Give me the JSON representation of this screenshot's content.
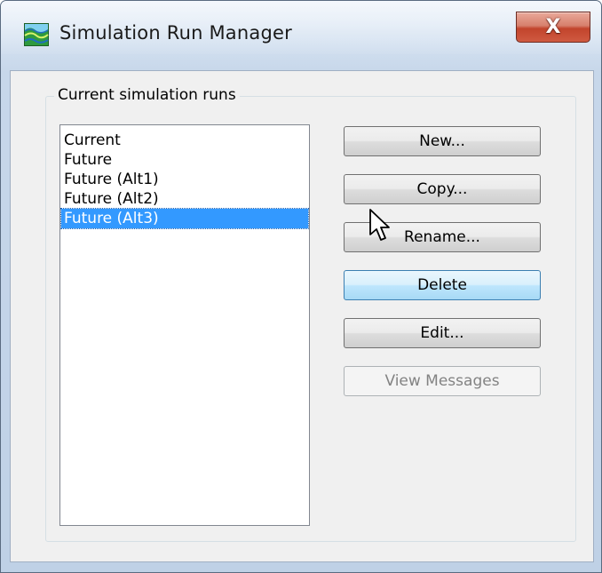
{
  "window": {
    "title": "Simulation Run Manager",
    "close_glyph": "X",
    "app_icon": "simulation-app-icon"
  },
  "group": {
    "title": "Current simulation runs"
  },
  "runs": {
    "items": [
      {
        "label": "Current",
        "selected": false
      },
      {
        "label": "Future",
        "selected": false
      },
      {
        "label": "Future (Alt1)",
        "selected": false
      },
      {
        "label": "Future (Alt2)",
        "selected": false
      },
      {
        "label": "Future (Alt3)",
        "selected": true
      }
    ]
  },
  "buttons": {
    "new_label": "New...",
    "copy_label": "Copy...",
    "rename_label": "Rename...",
    "delete_label": "Delete",
    "edit_label": "Edit...",
    "view_messages_label": "View Messages"
  },
  "colors": {
    "selection": "#3399ff",
    "close_button": "#c2442c",
    "hover_button": "#bee6fd"
  },
  "cursor": {
    "icon": "arrow-cursor-icon"
  }
}
